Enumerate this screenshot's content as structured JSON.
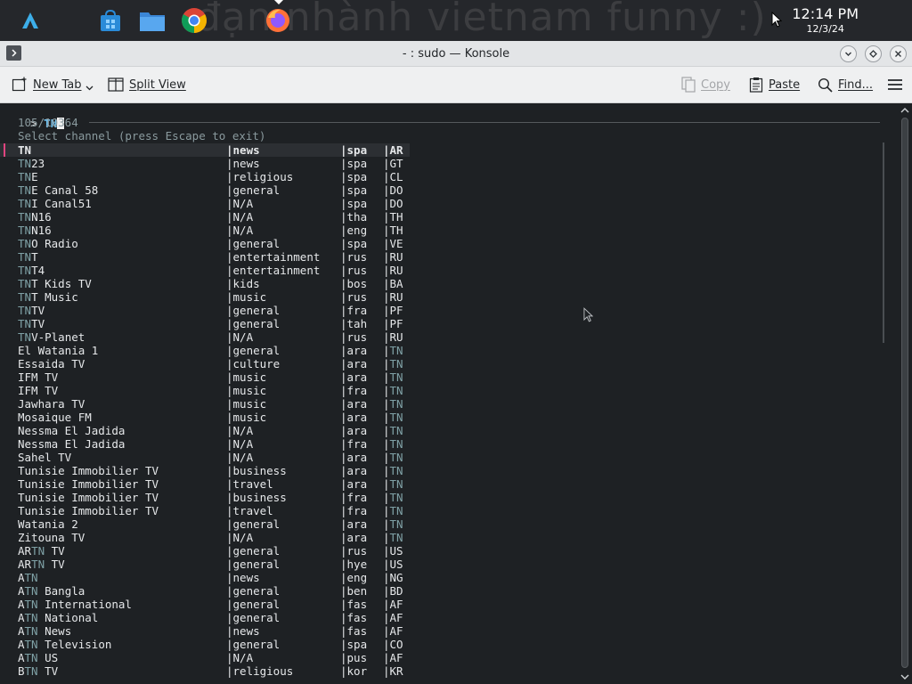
{
  "taskbar": {
    "wallpaper_text": "đạn nhành vietnam funny :)",
    "apps": [
      {
        "name": "launcher-icon"
      },
      {
        "name": "store-icon"
      },
      {
        "name": "file-manager-icon"
      },
      {
        "name": "chrome-icon"
      },
      {
        "name": "firefox-icon"
      }
    ],
    "clock_time": "12:14 PM",
    "clock_date": "12/3/24"
  },
  "window": {
    "title": "- : sudo — Konsole"
  },
  "toolbar": {
    "new_tab": "New Tab",
    "split_view": "Split View",
    "copy": "Copy",
    "paste": "Paste",
    "find": "Find..."
  },
  "terminal": {
    "prompt": "> ",
    "query": "TN",
    "count": "105/10364",
    "instruction": "Select channel (press Escape to exit)",
    "header": {
      "name": "TN",
      "category": "news",
      "lang": "spa",
      "country": "AR"
    },
    "rows": [
      {
        "name": "TN23",
        "category": "news",
        "lang": "spa",
        "country": "GT"
      },
      {
        "name": "TNE",
        "category": "religious",
        "lang": "spa",
        "country": "CL"
      },
      {
        "name": "TNE Canal 58",
        "category": "general",
        "lang": "spa",
        "country": "DO"
      },
      {
        "name": "TNI Canal51",
        "category": "N/A",
        "lang": "spa",
        "country": "DO"
      },
      {
        "name": "TNN16",
        "category": "N/A",
        "lang": "tha",
        "country": "TH"
      },
      {
        "name": "TNN16",
        "category": "N/A",
        "lang": "eng",
        "country": "TH"
      },
      {
        "name": "TNO Radio",
        "category": "general",
        "lang": "spa",
        "country": "VE"
      },
      {
        "name": "TNT",
        "category": "entertainment",
        "lang": "rus",
        "country": "RU"
      },
      {
        "name": "TNT4",
        "category": "entertainment",
        "lang": "rus",
        "country": "RU"
      },
      {
        "name": "TNT Kids TV",
        "category": "kids",
        "lang": "bos",
        "country": "BA"
      },
      {
        "name": "TNT Music",
        "category": "music",
        "lang": "rus",
        "country": "RU"
      },
      {
        "name": "TNTV",
        "category": "general",
        "lang": "fra",
        "country": "PF"
      },
      {
        "name": "TNTV",
        "category": "general",
        "lang": "tah",
        "country": "PF"
      },
      {
        "name": "TNV-Planet",
        "category": "N/A",
        "lang": "rus",
        "country": "RU"
      },
      {
        "name": "El Watania 1",
        "category": "general",
        "lang": "ara",
        "country": "TN"
      },
      {
        "name": "Essaida TV",
        "category": "culture",
        "lang": "ara",
        "country": "TN"
      },
      {
        "name": "IFM TV",
        "category": "music",
        "lang": "ara",
        "country": "TN"
      },
      {
        "name": "IFM TV",
        "category": "music",
        "lang": "fra",
        "country": "TN"
      },
      {
        "name": "Jawhara TV",
        "category": "music",
        "lang": "ara",
        "country": "TN"
      },
      {
        "name": "Mosaique FM",
        "category": "music",
        "lang": "ara",
        "country": "TN"
      },
      {
        "name": "Nessma El Jadida",
        "category": "N/A",
        "lang": "ara",
        "country": "TN"
      },
      {
        "name": "Nessma El Jadida",
        "category": "N/A",
        "lang": "fra",
        "country": "TN"
      },
      {
        "name": "Sahel TV",
        "category": "N/A",
        "lang": "ara",
        "country": "TN"
      },
      {
        "name": "Tunisie Immobilier TV",
        "category": "business",
        "lang": "ara",
        "country": "TN"
      },
      {
        "name": "Tunisie Immobilier TV",
        "category": "travel",
        "lang": "ara",
        "country": "TN"
      },
      {
        "name": "Tunisie Immobilier TV",
        "category": "business",
        "lang": "fra",
        "country": "TN"
      },
      {
        "name": "Tunisie Immobilier TV",
        "category": "travel",
        "lang": "fra",
        "country": "TN"
      },
      {
        "name": "Watania 2",
        "category": "general",
        "lang": "ara",
        "country": "TN"
      },
      {
        "name": "Zitouna TV",
        "category": "N/A",
        "lang": "ara",
        "country": "TN"
      },
      {
        "name": "ARTN TV",
        "category": "general",
        "lang": "rus",
        "country": "US"
      },
      {
        "name": "ARTN TV",
        "category": "general",
        "lang": "hye",
        "country": "US"
      },
      {
        "name": "ATN",
        "category": "news",
        "lang": "eng",
        "country": "NG"
      },
      {
        "name": "ATN Bangla",
        "category": "general",
        "lang": "ben",
        "country": "BD"
      },
      {
        "name": "ATN International",
        "category": "general",
        "lang": "fas",
        "country": "AF"
      },
      {
        "name": "ATN National",
        "category": "general",
        "lang": "fas",
        "country": "AF"
      },
      {
        "name": "ATN News",
        "category": "news",
        "lang": "fas",
        "country": "AF"
      },
      {
        "name": "ATN Television",
        "category": "general",
        "lang": "spa",
        "country": "CO"
      },
      {
        "name": "ATN US",
        "category": "N/A",
        "lang": "pus",
        "country": "AF"
      },
      {
        "name": "BTN TV",
        "category": "religious",
        "lang": "kor",
        "country": "KR"
      }
    ]
  }
}
